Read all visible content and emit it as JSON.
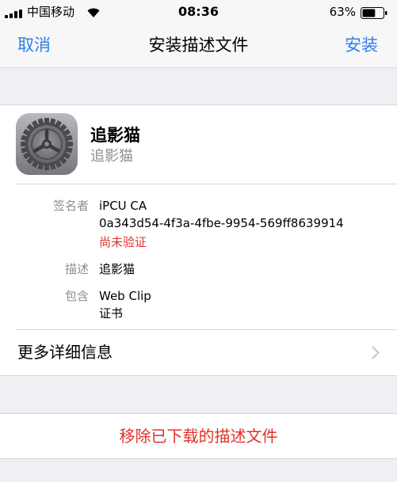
{
  "status_bar": {
    "carrier": "中国移动",
    "time": "08:36",
    "battery_percent": "63%",
    "battery_level": 0.63,
    "signal_icon": "cellular-signal-icon",
    "wifi_icon": "wifi-icon",
    "battery_icon": "battery-icon"
  },
  "nav": {
    "cancel_label": "取消",
    "title": "安装描述文件",
    "install_label": "安装",
    "accent_color": "#2f7ee6"
  },
  "profile": {
    "icon": "settings-gear-icon",
    "name": "追影猫",
    "subtitle": "追影猫"
  },
  "details": {
    "signed_by_label": "签名者",
    "signer_name": "iPCU CA",
    "signer_id": "0a343d54-4f3a-4fbe-9954-569ff8639914",
    "verification_status": "尚未验证",
    "description_label": "描述",
    "description_value": "追影猫",
    "contains_label": "包含",
    "contains_items": [
      "Web Clip",
      "证书"
    ]
  },
  "more_details": {
    "label": "更多详细信息",
    "icon": "chevron-right-icon"
  },
  "remove": {
    "label": "移除已下载的描述文件",
    "color": "#e0322a"
  }
}
